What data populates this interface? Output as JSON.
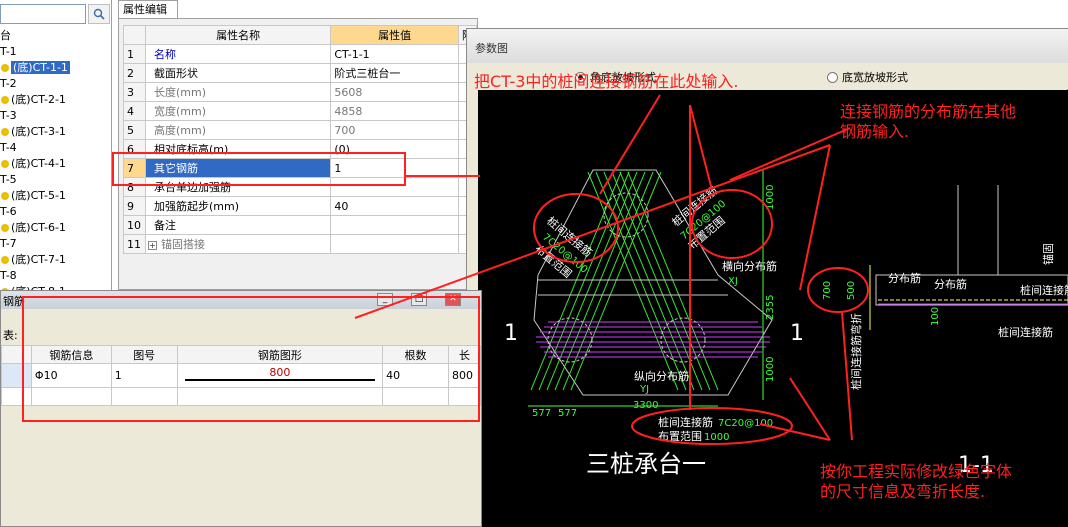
{
  "tree": {
    "items": [
      {
        "label": "台",
        "child": false
      },
      {
        "label": "T-1",
        "child": false
      },
      {
        "label": "(底)CT-1-1",
        "child": true,
        "selected": true
      },
      {
        "label": "T-2",
        "child": false
      },
      {
        "label": "(底)CT-2-1",
        "child": true
      },
      {
        "label": "T-3",
        "child": false
      },
      {
        "label": "(底)CT-3-1",
        "child": true
      },
      {
        "label": "T-4",
        "child": false
      },
      {
        "label": "(底)CT-4-1",
        "child": true
      },
      {
        "label": "T-5",
        "child": false
      },
      {
        "label": "(底)CT-5-1",
        "child": true
      },
      {
        "label": "T-6",
        "child": false
      },
      {
        "label": "(底)CT-6-1",
        "child": true
      },
      {
        "label": "T-7",
        "child": false
      },
      {
        "label": "(底)CT-7-1",
        "child": true
      },
      {
        "label": "T-8",
        "child": false
      },
      {
        "label": "(底)CT-8-1",
        "child": true
      }
    ],
    "search_icon": "search-icon"
  },
  "property_panel": {
    "tab_label": "属性编辑",
    "headers": {
      "name": "属性名称",
      "value": "属性值",
      "extra": "附"
    },
    "rows": [
      {
        "idx": "1",
        "name": "名称",
        "value": "CT-1-1",
        "style": "blue"
      },
      {
        "idx": "2",
        "name": "截面形状",
        "value": "阶式三桩台一",
        "style": ""
      },
      {
        "idx": "3",
        "name": "长度(mm)",
        "value": "5608",
        "style": "gray"
      },
      {
        "idx": "4",
        "name": "宽度(mm)",
        "value": "4858",
        "style": "gray"
      },
      {
        "idx": "5",
        "name": "高度(mm)",
        "value": "700",
        "style": "gray"
      },
      {
        "idx": "6",
        "name": "相对底标高(m)",
        "value": "(0)",
        "style": ""
      },
      {
        "idx": "7",
        "name": "其它钢筋",
        "value": "1",
        "style": "",
        "selected": true
      },
      {
        "idx": "8",
        "name": "承台单边加强筋",
        "value": "",
        "style": ""
      },
      {
        "idx": "9",
        "name": "加强筋起步(mm)",
        "value": "40",
        "style": ""
      },
      {
        "idx": "10",
        "name": "备注",
        "value": "",
        "style": ""
      },
      {
        "idx": "11",
        "name": "锚固搭接",
        "value": "",
        "style": "gray",
        "expandable": true
      }
    ]
  },
  "rebar_dialog": {
    "title": "钢筋",
    "label": "表:",
    "headers": [
      "钢筋信息",
      "图号",
      "钢筋图形",
      "根数",
      "长"
    ],
    "rows": [
      {
        "info": "Φ10",
        "fig_no": "1",
        "shape_len": "800",
        "count": "40",
        "length": "800"
      }
    ]
  },
  "param_dialog": {
    "title": "参数图",
    "radio_corner": "角底放坡形式",
    "radio_bottom": "底宽放坡形式"
  },
  "drawing": {
    "title": "三桩承台一",
    "section_label": "1",
    "section_label_right": "1-1",
    "labels": {
      "pile_conn1": "桩间连接筋",
      "pile_conn2": "桩间连接筋",
      "pile_conn3": "桩间连接筋",
      "range1": "布置范围",
      "range2": "布置范围",
      "range3": "布置范围",
      "spec1": "7C20@100",
      "spec2": "7C20@100",
      "spec3": "7C20@100",
      "horiz_dist": "横向分布筋",
      "vert_dist": "纵向分布筋",
      "xj": "XJ",
      "yj": "YJ",
      "dim_1000a": "1000",
      "dim_1000b": "1000",
      "dim_1000c": "1000",
      "dim_2355": "2355",
      "dim_577a": "577",
      "dim_577b": "577",
      "dim_3300": "3300",
      "dim_700": "700",
      "dim_500": "500",
      "dist_rebar1": "分布筋",
      "dist_rebar2": "分布筋",
      "conn_rebar_r": "桩间连接筋",
      "conn_rebar_r2": "桩间连接筋",
      "anchor": "锚固",
      "vertical_text": "桩间连接筋弯折",
      "dim_100": "100"
    }
  },
  "annotations": {
    "note1": "把CT-3中的桩间连接钢筋在此处输入.",
    "note2_line1": "连接钢筋的分布筋在其他",
    "note2_line2": "钢筋输入.",
    "note3_line1": "按你工程实际修改绿色字体",
    "note3_line2": "的尺寸信息及弯折长度."
  },
  "colors": {
    "accent": "#ff2020",
    "selection": "#316ac5",
    "header_highlight": "#ffd890",
    "cad_green": "#3cff3c",
    "cad_magenta": "#d040ff"
  }
}
